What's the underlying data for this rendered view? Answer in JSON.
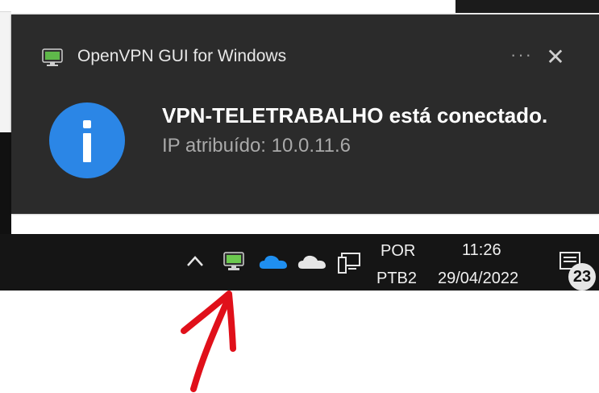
{
  "toast": {
    "app_name": "OpenVPN GUI for Windows",
    "more_label": "···",
    "close_label": "✕",
    "title": "VPN-TELETRABALHO está conectado.",
    "body": "IP atribuído: 10.0.11.6",
    "accent_color": "#2b86e6"
  },
  "taskbar": {
    "icons": [
      "chevron-up-icon",
      "openvpn-tray-icon",
      "onedrive-icon",
      "onedrive-personal-icon",
      "network-icon",
      "action-center-icon"
    ],
    "language_line1": "POR",
    "language_line2": "PTB2",
    "time": "11:26",
    "date": "29/04/2022",
    "notification_count": "23"
  },
  "annotation": {
    "arrow_color": "#e0101a"
  }
}
